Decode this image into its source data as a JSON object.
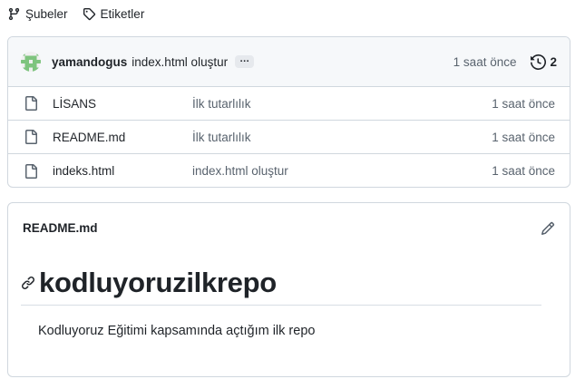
{
  "nav": {
    "branches_label": "Şubeler",
    "tags_label": "Etiketler"
  },
  "commit": {
    "author": "yamandogus",
    "message": "index.html oluştur",
    "ellipsis": "…",
    "time": "1 saat önce",
    "history_count": "2"
  },
  "files": [
    {
      "name": "LİSANS",
      "commit": "İlk tutarlılık",
      "date": "1 saat önce"
    },
    {
      "name": "README.md",
      "commit": "İlk tutarlılık",
      "date": "1 saat önce"
    },
    {
      "name": "indeks.html",
      "commit": "index.html oluştur",
      "date": "1 saat önce"
    }
  ],
  "readme": {
    "filename": "README.md",
    "heading": "kodluyoruzilkrepo",
    "paragraph": "Kodluyoruz Eğitimi kapsamında açtığım ilk repo"
  },
  "colors": {
    "border": "#d0d7de",
    "muted": "#59636e",
    "header_bg": "#f6f8fa",
    "avatar": "#7ec47e"
  }
}
